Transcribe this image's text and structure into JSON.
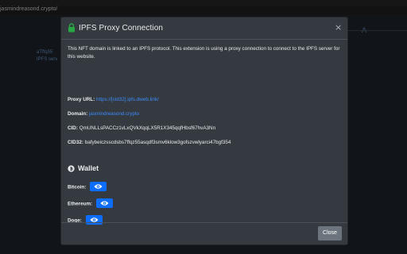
{
  "background": {
    "url_text": "jasmindreasond.crypto/",
    "left_text_line1": "aTffq55",
    "left_text_line2": "IPFS serv",
    "right_letter": "A"
  },
  "modal": {
    "title": "IPFS Proxy Connection",
    "close_symbol": "×",
    "intro": "This NFT domain is linked to an IPFS protocol. This extension is using a proxy connection to connect to the IPFS server for this website.",
    "proxy_url_label": "Proxy URL:",
    "proxy_url_value": "https://[cid32].ipfs.dweb.link/",
    "domain_label": "Domain:",
    "domain_value": "jasmindreasond.crypto",
    "cid_label": "CID:",
    "cid_value": "QmUNLLsPACCz1vLxQVkXqqLX5R1X345qqfHbsf67hvA3Nn",
    "cid32_label": "CID32:",
    "cid32_value": "bafybeiczsscdsbs7ffqz55asqdf3smv6klow3gofszvwlyarci47bgf354",
    "wallet_heading": "Wallet",
    "wallet_items": [
      {
        "label": "Bitcoin:"
      },
      {
        "label": "Ethereum:"
      },
      {
        "label": "Doge:"
      }
    ],
    "close_button_label": "Close"
  },
  "colors": {
    "modal_bg": "#343a40",
    "link": "#3d8bfd",
    "primary_button": "#0d6efd",
    "secondary_button": "#6c757d",
    "lock_icon": "#28a745"
  }
}
